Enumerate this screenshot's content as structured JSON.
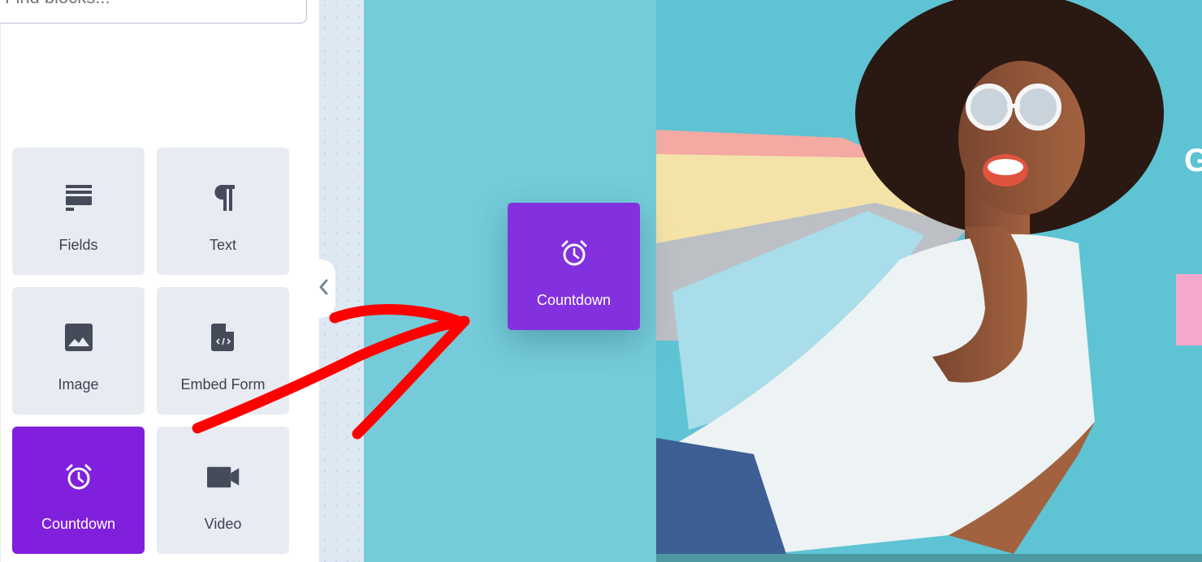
{
  "sidebar": {
    "search": {
      "placeholder": "Find blocks...",
      "value": ""
    },
    "blocks": [
      {
        "label": "Fields",
        "icon": "fields-icon",
        "active": false
      },
      {
        "label": "Text",
        "icon": "paragraph-icon",
        "active": false
      },
      {
        "label": "Image",
        "icon": "image-icon",
        "active": false
      },
      {
        "label": "Embed Form",
        "icon": "embed-code-file-icon",
        "active": false
      },
      {
        "label": "Countdown",
        "icon": "alarm-clock-icon",
        "active": true
      },
      {
        "label": "Video",
        "icon": "video-camera-icon",
        "active": false
      }
    ],
    "collapse_icon": "chevron-left-icon"
  },
  "canvas": {
    "dragged_block": {
      "label": "Countdown",
      "icon": "alarm-clock-icon"
    },
    "hero": {
      "image_alt": "Woman in sunglasses holding colorful shopping bags",
      "headline_partial": "G"
    }
  },
  "colors": {
    "accent_purple": "#8120dc",
    "drag_purple": "#8331de",
    "block_bg": "#e8ebf2",
    "canvas_teal": "#75cbd9",
    "hero_teal": "#5ec3d3",
    "annotation_red": "#ff0000",
    "pink_button": "#f7a8cd"
  }
}
